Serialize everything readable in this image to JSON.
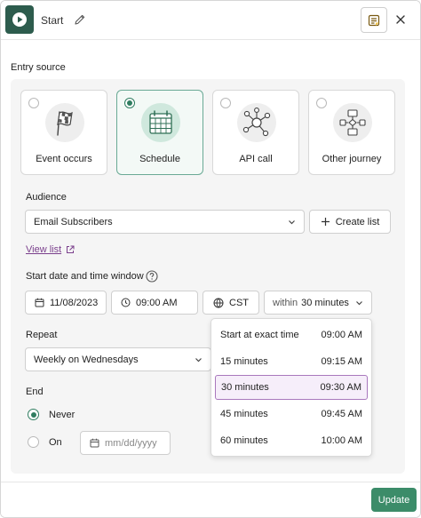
{
  "header": {
    "title": "Start"
  },
  "entry_source": {
    "title": "Entry source",
    "cards": [
      {
        "label": "Event occurs",
        "selected": false,
        "icon": "checkered-flag-icon"
      },
      {
        "label": "Schedule",
        "selected": true,
        "icon": "calendar-icon"
      },
      {
        "label": "API call",
        "selected": false,
        "icon": "network-nodes-icon"
      },
      {
        "label": "Other journey",
        "selected": false,
        "icon": "flowchart-icon"
      }
    ]
  },
  "audience": {
    "label": "Audience",
    "value": "Email Subscribers",
    "create_label": "Create list",
    "view_link": "View list"
  },
  "window": {
    "label": "Start date and time window",
    "date": "11/08/2023",
    "time": "09:00 AM",
    "tz": "CST",
    "within_prefix": "within",
    "within_value": "30 minutes"
  },
  "repeat": {
    "label": "Repeat",
    "value": "Weekly on Wednesdays"
  },
  "end": {
    "label": "End",
    "never_label": "Never",
    "on_label": "On",
    "date_placeholder": "mm/dd/yyyy",
    "selected": "never"
  },
  "dropdown": {
    "options": [
      {
        "label": "Start at exact time",
        "time": "09:00 AM",
        "active": false
      },
      {
        "label": "15 minutes",
        "time": "09:15 AM",
        "active": false
      },
      {
        "label": "30 minutes",
        "time": "09:30 AM",
        "active": true
      },
      {
        "label": "45 minutes",
        "time": "09:45 AM",
        "active": false
      },
      {
        "label": "60 minutes",
        "time": "10:00 AM",
        "active": false
      }
    ]
  },
  "footer": {
    "update_label": "Update"
  },
  "colors": {
    "brand": "#2d5c4d",
    "accent": "#3c8c69",
    "selected_option": "#a978bd",
    "link": "#7a3f8c"
  }
}
